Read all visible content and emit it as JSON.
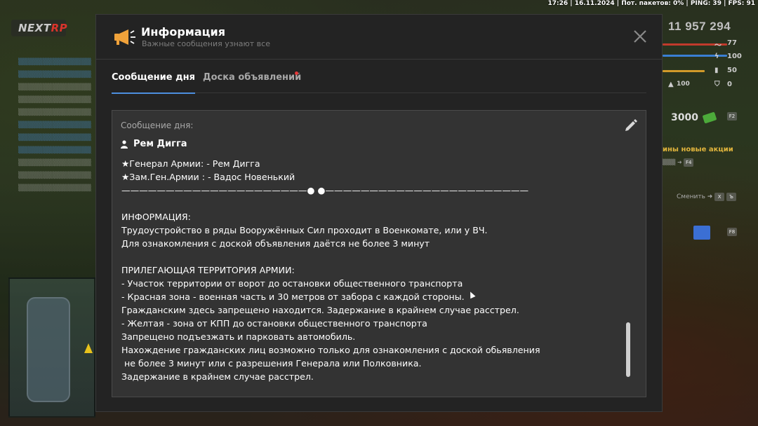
{
  "status_bar": {
    "text": "17:26 | 16.11.2024 | Пот. пакетов: 0% | PING: 39 | FPS: 91"
  },
  "hud": {
    "money": "11 957 294",
    "stats": [
      {
        "value": "77",
        "icon": "pulse-icon"
      },
      {
        "value": "100",
        "icon": "lightning-icon"
      },
      {
        "value": "50",
        "icon": "food-icon"
      },
      {
        "value": "100",
        "icon": "level-icon"
      },
      {
        "value": "0",
        "icon": "shield-icon"
      }
    ],
    "bonus_value": "3000",
    "promo_text": "ины новые акции",
    "change_label": "Сменить"
  },
  "modal": {
    "title": "Информация",
    "subtitle": "Важные сообщения узнают все",
    "tabs": [
      {
        "label": "Сообщение дня",
        "active": true
      },
      {
        "label": "Доска объявлений",
        "active": false,
        "has_notification": true
      }
    ],
    "content": {
      "label": "Сообщение дня:",
      "author": "Рем Дигга",
      "lines": [
        "★Генерал Армии: - Рем Дигга",
        "★Зам.Ген.Армии : - Вадос Новенький",
        "—————————————————————● ●———————————————————————",
        "",
        "ИНФОРМАЦИЯ:",
        "Трудоустройство в ряды Вооружённых Сил проходит в Военкомате, или у ВЧ.",
        "Для ознакомления с доской объявления даётся не более 3 минут",
        "",
        "ПРИЛЕГАЮЩАЯ ТЕРРИТОРИЯ АРМИИ:",
        "- Участок территории от ворот до остановки общественного транспорта",
        "- Красная зона - военная часть и 30 метров от забора с каждой стороны.",
        "Гражданским здесь запрещено находится. Задержание в крайнем случае расстрел.",
        "- Желтая - зона от КПП до остановки общественного транспорта",
        "Запрещено подъезжать и парковать автомобиль.",
        "Нахождение гражданских лиц возможно только для ознакомления с доской обьявления",
        " не более 3 минут или с разрешения Генерала или Полковника.",
        "Задержание в крайнем случае расстрел."
      ]
    }
  },
  "colors": {
    "accent": "#4d8fe0",
    "notification": "#e63838",
    "megaphone": "#f0a23a"
  }
}
